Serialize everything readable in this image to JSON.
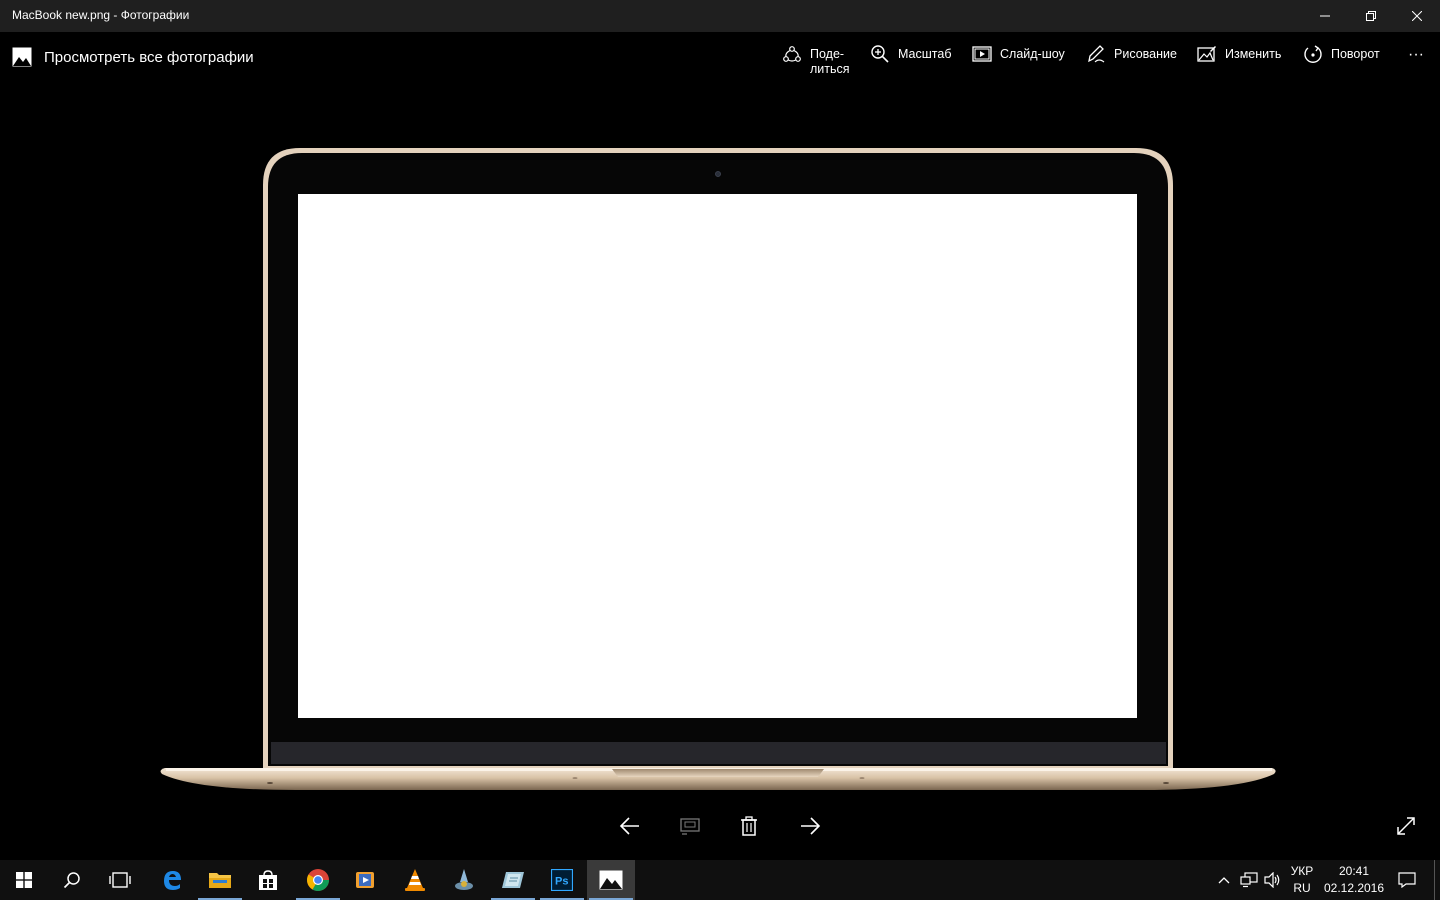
{
  "window": {
    "title": "MacBook new.png - Фотографии"
  },
  "toolbar": {
    "view_all": "Просмотреть все фотографии",
    "share_line1": "Поде-",
    "share_line2": "литься",
    "zoom": "Масштаб",
    "slideshow": "Слайд-шоу",
    "draw": "Рисование",
    "edit": "Изменить",
    "rotate": "Поворот",
    "more": "···"
  },
  "photo_nav": {
    "icons": [
      "arrow-left-icon",
      "slideshow-cast-icon",
      "trash-icon",
      "arrow-right-icon",
      "fullscreen-icon"
    ]
  },
  "taskbar": {
    "apps": [
      "start",
      "search",
      "task-view",
      "edge",
      "file-explorer",
      "store",
      "chrome",
      "media-player",
      "vlc",
      "app",
      "app",
      "photoshop",
      "photos"
    ]
  },
  "tray": {
    "language_line1": "УКР",
    "language_line2": "RU",
    "time": "20:41",
    "date": "02.12.2016"
  },
  "colors": {
    "titlebar": "#1f1f1f",
    "background": "#000000",
    "taskbar": "#101010",
    "accent": "#0078d7",
    "laptop_gold": "#e4d2bd"
  }
}
